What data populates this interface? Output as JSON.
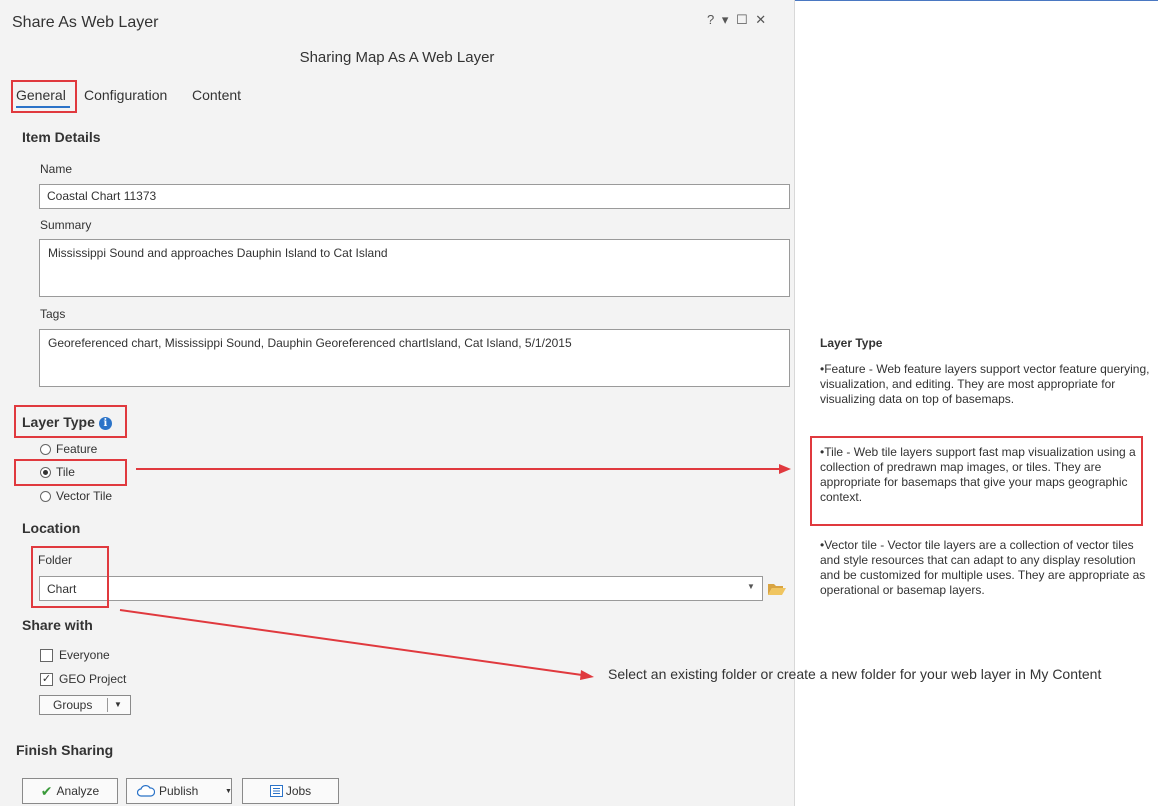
{
  "window": {
    "title": "Share As Web Layer",
    "controls": "? ▾ ☐ ✕",
    "subtitle": "Sharing Map As A Web Layer"
  },
  "tabs": [
    {
      "label": "General",
      "active": true
    },
    {
      "label": "Configuration",
      "active": false
    },
    {
      "label": "Content",
      "active": false
    }
  ],
  "item_details": {
    "heading": "Item Details",
    "name_label": "Name",
    "name_value": "Coastal Chart 11373",
    "summary_label": "Summary",
    "summary_value": "Mississippi Sound and approaches Dauphin Island to Cat Island",
    "tags_label": "Tags",
    "tags_value": "Georeferenced chart, Mississippi Sound, Dauphin Georeferenced chartIsland, Cat Island, 5/1/2015"
  },
  "layer_type": {
    "heading": "Layer Type",
    "options": [
      {
        "label": "Feature",
        "selected": false
      },
      {
        "label": "Tile",
        "selected": true
      },
      {
        "label": "Vector Tile",
        "selected": false
      }
    ]
  },
  "location": {
    "heading": "Location",
    "folder_label": "Folder",
    "folder_value": "Chart"
  },
  "share_with": {
    "heading": "Share with",
    "options": [
      {
        "label": "Everyone",
        "checked": false
      },
      {
        "label": "GEO Project",
        "checked": true
      }
    ],
    "groups_label": "Groups"
  },
  "finish": {
    "heading": "Finish Sharing",
    "analyze_label": "Analyze",
    "publish_label": "Publish",
    "jobs_label": "Jobs"
  },
  "help": {
    "heading": "Layer Type",
    "feature_text": "•Feature - Web feature layers support vector feature querying, visualization, and editing. They are most appropriate for visualizing data on top of basemaps.",
    "tile_text": "•Tile - Web tile layers support fast map visualization using a collection of predrawn map images, or tiles. They are appropriate for basemaps that give your maps geographic context.",
    "vector_text": "•Vector tile - Vector tile layers are a collection of vector tiles and style resources that can adapt to any display resolution and be customized for multiple uses. They are appropriate as operational or basemap layers."
  },
  "annotation": {
    "folder_note": "Select an existing folder or create a new folder for your web layer in My Content"
  },
  "colors": {
    "highlight": "#e0393e",
    "accent": "#2b73c8"
  }
}
